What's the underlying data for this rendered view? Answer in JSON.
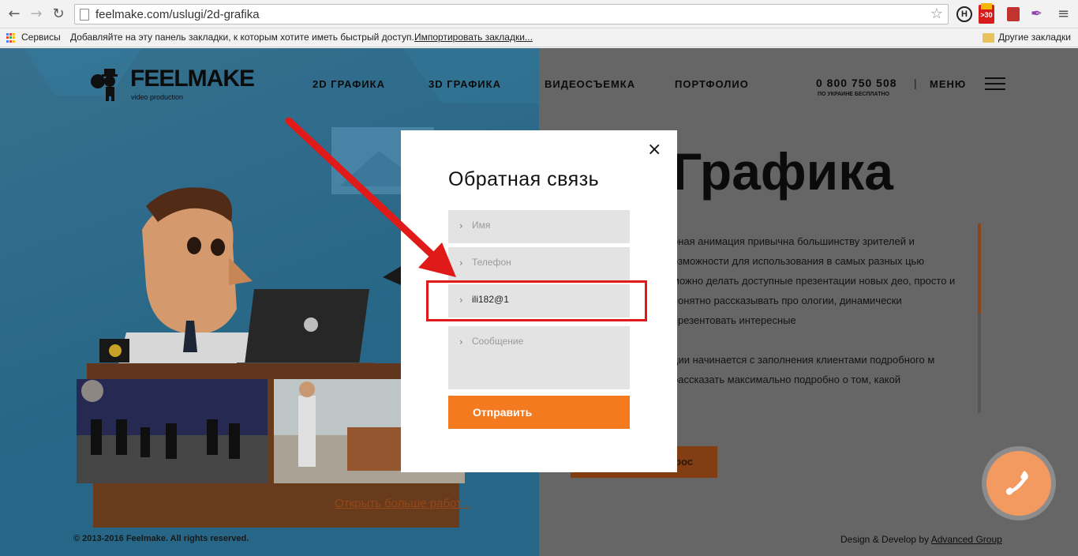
{
  "browser": {
    "url": "feelmake.com/uslugi/2d-grafika",
    "bookmarks": {
      "services": "Сервисы",
      "hint": "Добавляйте на эту панель закладки, к которым хотите иметь быстрый доступ.",
      "import": "Импортировать закладки...",
      "other": "Другие закладки"
    },
    "ext_h": "H",
    "ext_30": ">30"
  },
  "site": {
    "logo": "FEELMAKE",
    "logo_sub": "video production",
    "nav": [
      "2D ГРАФИКА",
      "3D ГРАФИКА",
      "ВИДЕОСЪЕМКА",
      "ПОРТФОЛИО"
    ],
    "phone": "0 800 750 508",
    "phone_note": "ПО УКРАИНЕ БЕСПЛАТНО",
    "menu_label": "МЕНЮ",
    "hero_title": "Графика",
    "hero_p1": "рная анимация привычна большинству зрителей и озможности для использования в самых разных цью можно делать доступные презентации новых део, просто и понятно рассказывать про ологии, динамически презентовать интересные",
    "hero_p2": "ции начинается с заполнения клиентами подробного м рассказать максимально подробно о том, какой",
    "cta_label": "рос",
    "more_works": "Открыть больше работ...",
    "copyright": "© 2013-2016 Feelmake. All rights reserved.",
    "credits_prefix": "Design & Develop by ",
    "credits_link": "Advanced Group"
  },
  "modal": {
    "title": "Обратная связь",
    "name_placeholder": "Имя",
    "phone_placeholder": "Телефон",
    "email_value": "ili182@1",
    "message_placeholder": "Сообщение",
    "submit_label": "Отправить"
  },
  "colors": {
    "left_bg": "#2b6f92",
    "right_bg": "#6f6f6f",
    "accent_orange": "#f47a20",
    "annotation_red": "#e01919",
    "fab": "#f39a61"
  }
}
